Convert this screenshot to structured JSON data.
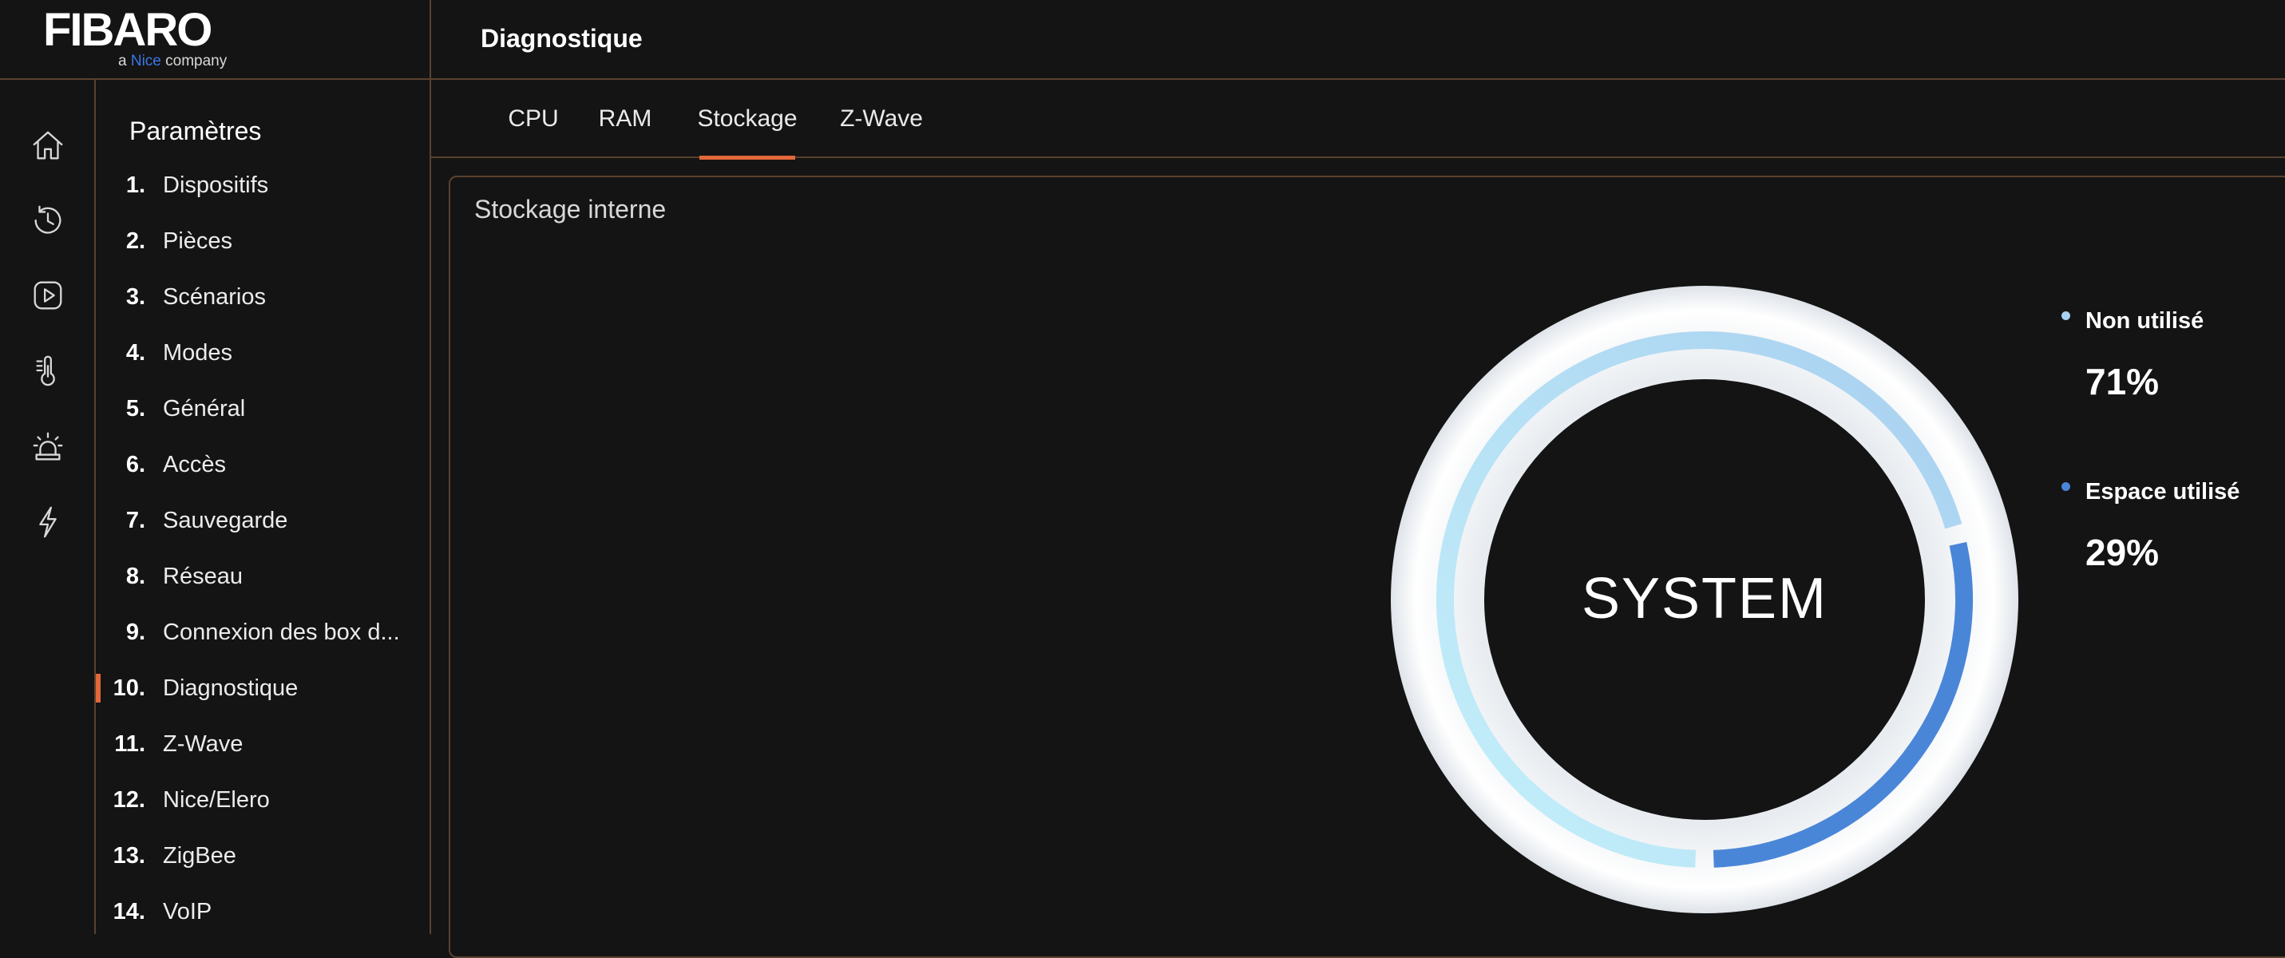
{
  "logo": {
    "main": "FIBARO",
    "sub_prefix": "a",
    "sub_brand": "Nice",
    "sub_suffix": "company"
  },
  "header": {
    "title": "Diagnostique"
  },
  "rail": {
    "icons": [
      "home-icon",
      "history-clock-icon",
      "play-icon",
      "thermometer-icon",
      "alarm-siren-icon",
      "lightning-icon"
    ]
  },
  "menu": {
    "title": "Paramètres",
    "items": [
      {
        "num": "1.",
        "label": "Dispositifs"
      },
      {
        "num": "2.",
        "label": "Pièces"
      },
      {
        "num": "3.",
        "label": "Scénarios"
      },
      {
        "num": "4.",
        "label": "Modes"
      },
      {
        "num": "5.",
        "label": "Général"
      },
      {
        "num": "6.",
        "label": "Accès"
      },
      {
        "num": "7.",
        "label": "Sauvegarde"
      },
      {
        "num": "8.",
        "label": "Réseau"
      },
      {
        "num": "9.",
        "label": "Connexion des box d..."
      },
      {
        "num": "10.",
        "label": "Diagnostique"
      },
      {
        "num": "11.",
        "label": "Z-Wave"
      },
      {
        "num": "12.",
        "label": "Nice/Elero"
      },
      {
        "num": "13.",
        "label": "ZigBee"
      },
      {
        "num": "14.",
        "label": "VoIP"
      }
    ],
    "active_index": 9
  },
  "tabs": {
    "items": [
      "CPU",
      "RAM",
      "Stockage",
      "Z-Wave"
    ],
    "active_index": 2
  },
  "card": {
    "title": "Stockage interne",
    "center_label": "SYSTEM"
  },
  "legend": {
    "unused": {
      "label": "Non utilisé",
      "value": "71%",
      "color": "#a8d0f0"
    },
    "used": {
      "label": "Espace utilisé",
      "value": "29%",
      "color": "#4a86d8"
    }
  },
  "storage": {
    "unused_percent": 71,
    "used_percent": 29
  },
  "colors": {
    "accent": "#e2683a",
    "border": "#5a4230",
    "background": "#141414"
  }
}
